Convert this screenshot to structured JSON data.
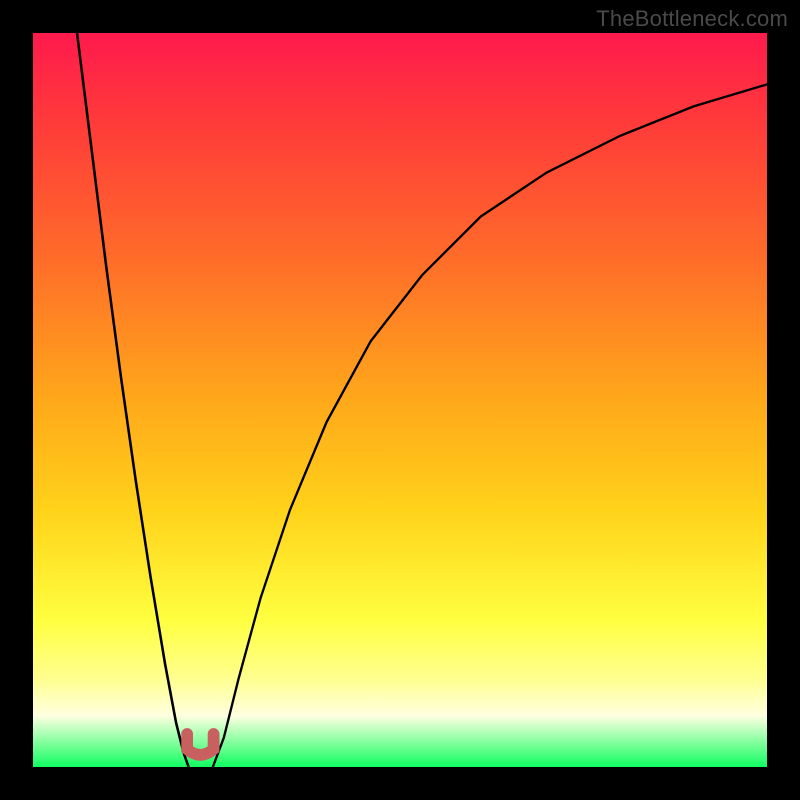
{
  "watermark": "TheBottleneck.com",
  "chart_data": {
    "type": "line",
    "title": "",
    "xlabel": "",
    "ylabel": "",
    "xlim": [
      0,
      100
    ],
    "ylim": [
      0,
      100
    ],
    "grid": false,
    "legend": false,
    "annotations": [],
    "colors": {
      "gradient_top": "#ff1a4d",
      "gradient_bottom": "#10ff60",
      "curve": "#000000",
      "bump": "#c86060"
    },
    "series": [
      {
        "name": "left-branch",
        "x": [
          6,
          8,
          10,
          12,
          14,
          16,
          18,
          19.5,
          20.5,
          21.2
        ],
        "y": [
          100,
          84,
          68,
          53,
          39,
          26,
          14,
          6,
          2,
          0
        ]
      },
      {
        "name": "right-branch",
        "x": [
          24.5,
          26,
          28,
          31,
          35,
          40,
          46,
          53,
          61,
          70,
          80,
          90,
          100
        ],
        "y": [
          0,
          4,
          12,
          23,
          35,
          47,
          58,
          67,
          75,
          81,
          86,
          90,
          93
        ]
      }
    ],
    "bump": {
      "comment": "small U-shaped marker at the minimum",
      "cx": 22.8,
      "cy": 1.3,
      "width": 3.6,
      "height": 3.2
    }
  }
}
